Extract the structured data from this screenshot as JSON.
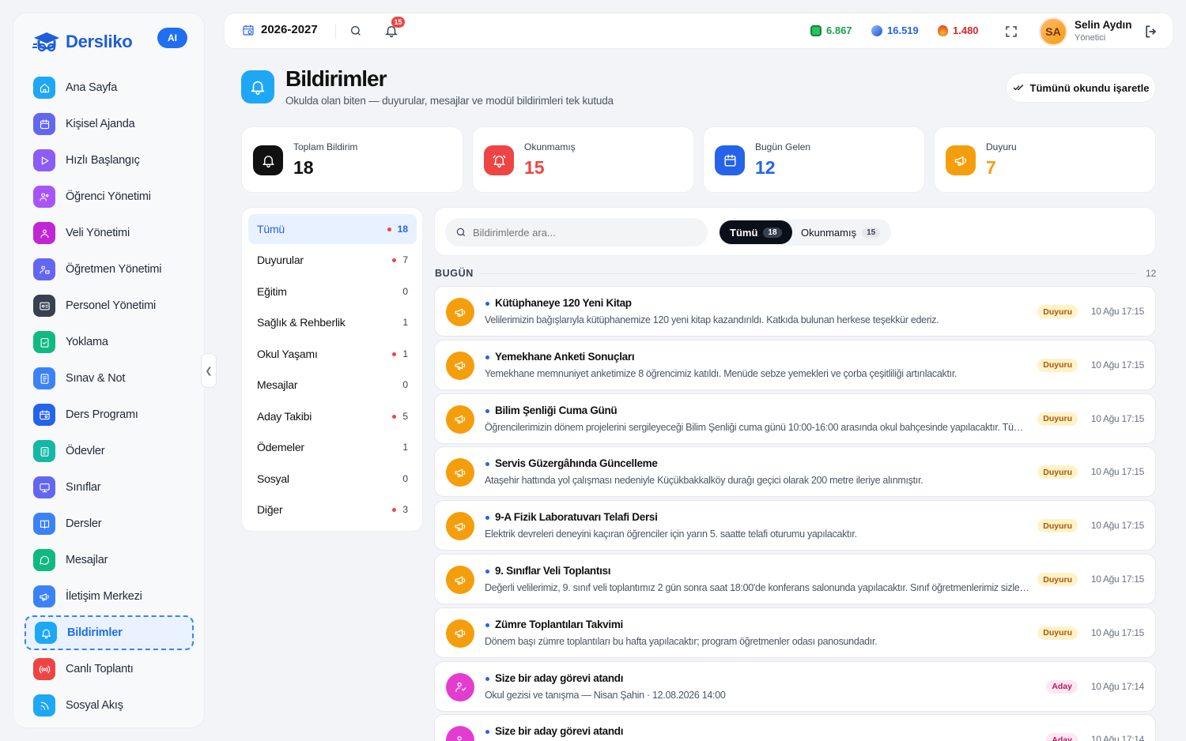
{
  "brand": {
    "name": "Dersliko",
    "ai_label": "AI"
  },
  "sidebar": {
    "items": [
      {
        "label": "Ana Sayfa",
        "icon": "home-icon",
        "color": "#1ea7f5"
      },
      {
        "label": "Kişisel Ajanda",
        "icon": "calendar-icon",
        "color": "#6366f1"
      },
      {
        "label": "Hızlı Başlangıç",
        "icon": "play-icon",
        "color": "#8b5cf6"
      },
      {
        "label": "Öğrenci Yönetimi",
        "icon": "users-icon",
        "color": "#a855f7"
      },
      {
        "label": "Veli Yönetimi",
        "icon": "user-group-icon",
        "color": "#c026d3"
      },
      {
        "label": "Öğretmen Yönetimi",
        "icon": "teacher-icon",
        "color": "#6366f1"
      },
      {
        "label": "Personel Yönetimi",
        "icon": "id-card-icon",
        "color": "#374151"
      },
      {
        "label": "Yoklama",
        "icon": "clipboard-check-icon",
        "color": "#10b981"
      },
      {
        "label": "Sınav & Not",
        "icon": "exam-icon",
        "color": "#3b82f6"
      },
      {
        "label": "Ders Programı",
        "icon": "schedule-icon",
        "color": "#2563eb"
      },
      {
        "label": "Ödevler",
        "icon": "clipboard-icon",
        "color": "#14b8a6"
      },
      {
        "label": "Sınıflar",
        "icon": "monitor-icon",
        "color": "#6366f1"
      },
      {
        "label": "Dersler",
        "icon": "book-icon",
        "color": "#3b82f6"
      },
      {
        "label": "Mesajlar",
        "icon": "message-icon",
        "color": "#10b981"
      },
      {
        "label": "İletişim Merkezi",
        "icon": "megaphone-icon",
        "color": "#3b82f6"
      },
      {
        "label": "Bildirimler",
        "icon": "bell-icon",
        "color": "#1ea7f5",
        "active": true
      },
      {
        "label": "Canlı Toplantı",
        "icon": "broadcast-icon",
        "color": "#ef4444"
      },
      {
        "label": "Sosyal Akış",
        "icon": "rss-icon",
        "color": "#1ea7f5"
      }
    ]
  },
  "topbar": {
    "year": "2026-2027",
    "bell_count": "15",
    "stats": [
      {
        "value": "6.867",
        "color": "#16a34a",
        "icon": "money-icon"
      },
      {
        "value": "16.519",
        "color": "#2563eb",
        "icon": "diamond-icon"
      },
      {
        "value": "1.480",
        "color": "#dc2626",
        "icon": "flame-icon"
      }
    ],
    "user": {
      "initials": "SA",
      "name": "Selin Aydın",
      "role": "Yönetici"
    }
  },
  "header": {
    "title": "Bildirimler",
    "subtitle": "Okulda olan biten — duyurular, mesajlar ve modül bildirimleri tek kutuda",
    "mark_all": "Tümünü okundu işaretle"
  },
  "cards": [
    {
      "label": "Toplam Bildirim",
      "value": "18",
      "color": "#111111",
      "icon": "bell-icon"
    },
    {
      "label": "Okunmamış",
      "value": "15",
      "color": "#ef4444",
      "icon": "bell-alert-icon"
    },
    {
      "label": "Bugün Gelen",
      "value": "12",
      "color": "#2563eb",
      "icon": "calendar-icon"
    },
    {
      "label": "Duyuru",
      "value": "7",
      "color": "#f59e0b",
      "icon": "megaphone-icon"
    }
  ],
  "categories": [
    {
      "name": "Tümü",
      "count": "18",
      "dot": true,
      "active": true
    },
    {
      "name": "Duyurular",
      "count": "7",
      "dot": true
    },
    {
      "name": "Eğitim",
      "count": "0",
      "dot": false
    },
    {
      "name": "Sağlık & Rehberlik",
      "count": "1",
      "dot": false
    },
    {
      "name": "Okul Yaşamı",
      "count": "1",
      "dot": true
    },
    {
      "name": "Mesajlar",
      "count": "0",
      "dot": false
    },
    {
      "name": "Aday Takibi",
      "count": "5",
      "dot": true
    },
    {
      "name": "Ödemeler",
      "count": "1",
      "dot": false
    },
    {
      "name": "Sosyal",
      "count": "0",
      "dot": false
    },
    {
      "name": "Diğer",
      "count": "3",
      "dot": true
    }
  ],
  "filter": {
    "search_placeholder": "Bildirimlerde ara...",
    "tabs": [
      {
        "label": "Tümü",
        "count": "18",
        "active": true
      },
      {
        "label": "Okunmamış",
        "count": "15",
        "active": false
      }
    ]
  },
  "group": {
    "label": "BUGÜN",
    "count": "12"
  },
  "notifications": [
    {
      "title": "Kütüphaneye 120 Yeni Kitap",
      "body": "Velilerimizin bağışlarıyla kütüphanemize 120 yeni kitap kazandırıldı. Katkıda bulunan herkese teşekkür ederiz.",
      "tag": "Duyuru",
      "time": "10 Ağu 17:15",
      "kind": "duyuru"
    },
    {
      "title": "Yemekhane Anketi Sonuçları",
      "body": "Yemekhane memnuniyet anketimize 8 öğrencimiz katıldı. Menüde sebze yemekleri ve çorba çeşitliliği artırılacaktır.",
      "tag": "Duyuru",
      "time": "10 Ağu 17:15",
      "kind": "duyuru"
    },
    {
      "title": "Bilim Şenliği Cuma Günü",
      "body": "Öğrencilerimizin dönem projelerini sergileyeceği Bilim Şenliği cuma günü 10:00-16:00 arasında okul bahçesinde yapılacaktır. Tüm velilerimiz davetlidir.",
      "tag": "Duyuru",
      "time": "10 Ağu 17:15",
      "kind": "duyuru"
    },
    {
      "title": "Servis Güzergâhında Güncelleme",
      "body": "Ataşehir hattında yol çalışması nedeniyle Küçükbakkalköy durağı geçici olarak 200 metre ileriye alınmıştır.",
      "tag": "Duyuru",
      "time": "10 Ağu 17:15",
      "kind": "duyuru"
    },
    {
      "title": "9-A Fizik Laboratuvarı Telafi Dersi",
      "body": "Elektrik devreleri deneyini kaçıran öğrenciler için yarın 5. saatte telafi oturumu yapılacaktır.",
      "tag": "Duyuru",
      "time": "10 Ağu 17:15",
      "kind": "duyuru"
    },
    {
      "title": "9. Sınıflar Veli Toplantısı",
      "body": "Değerli velilerimiz, 9. sınıf veli toplantımız 2 gün sonra saat 18:00'de konferans salonunda yapılacaktır. Sınıf öğretmenlerimiz sizleri bekliyor.",
      "tag": "Duyuru",
      "time": "10 Ağu 17:15",
      "kind": "duyuru"
    },
    {
      "title": "Zümre Toplantıları Takvimi",
      "body": "Dönem başı zümre toplantıları bu hafta yapılacaktır; program öğretmenler odası panosundadır.",
      "tag": "Duyuru",
      "time": "10 Ağu 17:15",
      "kind": "duyuru"
    },
    {
      "title": "Size bir aday görevi atandı",
      "body": "Okul gezisi ve tanışma — Nisan Şahin · 12.08.2026 14:00",
      "tag": "Aday",
      "time": "10 Ağu 17:14",
      "kind": "aday"
    },
    {
      "title": "Size bir aday görevi atandı",
      "body": "",
      "tag": "Aday",
      "time": "10 Ağu 17:14",
      "kind": "aday"
    }
  ]
}
